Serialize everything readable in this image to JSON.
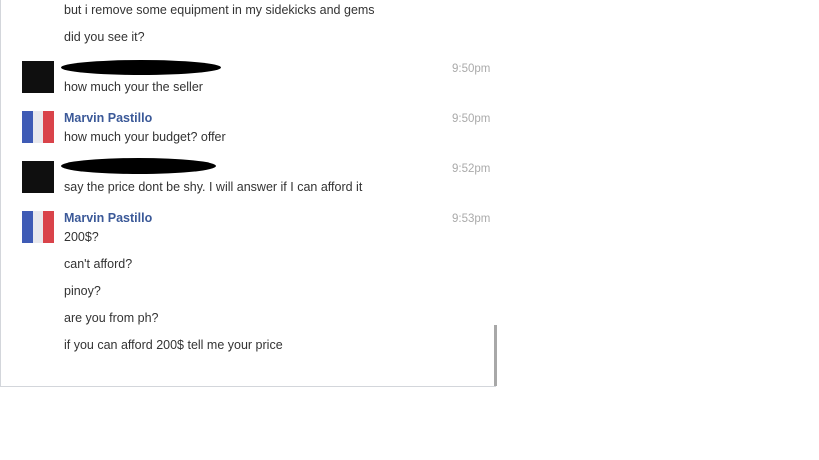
{
  "messages": {
    "m1": "but i remove some equipment in my sidekicks and gems",
    "m2": "did you see it?",
    "m3": "how much your the seller",
    "m4": "how much your budget? offer",
    "m5": "say the price dont be shy. I will answer if I can afford it",
    "m6": "200$?",
    "m7": "can't afford?",
    "m8": "pinoy?",
    "m9": "are you from ph?",
    "m10": "if you can afford 200$ tell me your price"
  },
  "senders": {
    "marvin": "Marvin Pastillo"
  },
  "times": {
    "t1": "9:50pm",
    "t2": "9:50pm",
    "t3": "9:52pm",
    "t4": "9:53pm"
  }
}
